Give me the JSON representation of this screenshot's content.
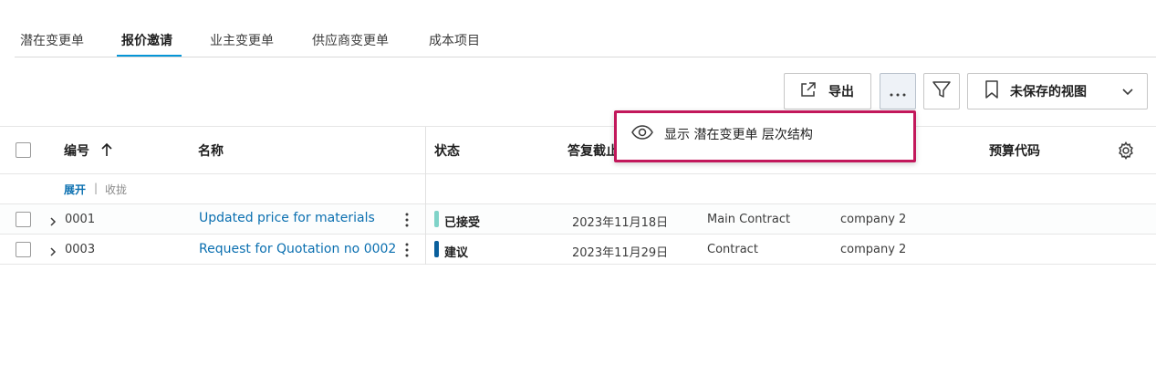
{
  "tabs": [
    {
      "label": "潜在变更单"
    },
    {
      "label": "报价邀请"
    },
    {
      "label": "业主变更单"
    },
    {
      "label": "供应商变更单"
    },
    {
      "label": "成本项目"
    }
  ],
  "toolbar": {
    "export_label": "导出",
    "view_label": "未保存的视图"
  },
  "menu": {
    "item_label": "显示 潜在变更单 层次结构"
  },
  "table": {
    "headers": {
      "number": "编号",
      "name": "名称",
      "status": "状态",
      "due_date": "答复截止",
      "budget_code": "预算代码"
    },
    "expand_label": "展开",
    "separator": "|",
    "collapse_label": "收拢",
    "rows": [
      {
        "number": "0001",
        "name": "Updated price for materials",
        "status": "已接受",
        "status_color": "#7fd3c8",
        "date": "2023年11月18日",
        "contract": "Main Contract",
        "company": "company 2"
      },
      {
        "number": "0003",
        "name": "Request for Quotation no 0002",
        "status": "建议",
        "status_color": "#0a5f9c",
        "date": "2023年11月29日",
        "contract": "Contract",
        "company": "company 2"
      }
    ]
  },
  "colors": {
    "accent": "#0696d7",
    "link": "#0a6fb0",
    "highlight_border": "#c2185b"
  }
}
